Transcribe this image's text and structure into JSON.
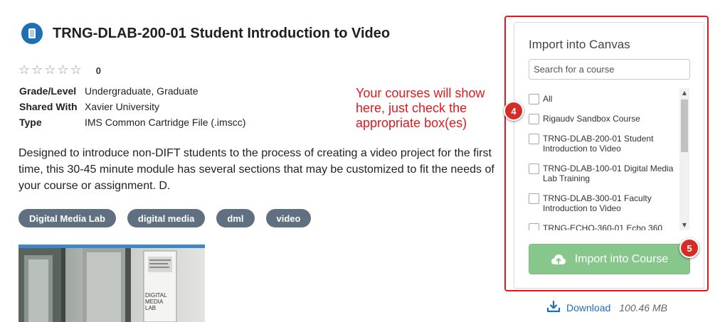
{
  "resource": {
    "title": "TRNG-DLAB-200-01 Student Introduction to Video",
    "rating_count": "0",
    "meta": [
      {
        "label": "Grade/Level",
        "value": "Undergraduate, Graduate"
      },
      {
        "label": "Shared With",
        "value": "Xavier University"
      },
      {
        "label": "Type",
        "value": "IMS Common Cartridge File (.imscc)"
      }
    ],
    "description": "Designed to introduce non-DIFT students to the process of creating a video project for the first time, this 30-45 minute module has several sections that may be customized to fit the needs of your course or assignment. D.",
    "tags": [
      "Digital Media Lab",
      "digital media",
      "dml",
      "video"
    ],
    "thumbnail_sign_text": "DIGITAL MEDIA LAB"
  },
  "annotation": {
    "text_lines": [
      "Your courses will show",
      "here, just check the",
      "appropriate box(es)"
    ],
    "color": "#e0191d"
  },
  "import_panel": {
    "title": "Import into Canvas",
    "search_placeholder": "Search for a course",
    "courses": [
      {
        "label": "All",
        "checked": false
      },
      {
        "label": "Rigaudv Sandbox Course",
        "checked": false
      },
      {
        "label": "TRNG-DLAB-200-01 Student Introduction to Video",
        "checked": false
      },
      {
        "label": "TRNG-DLAB-100-01 Digital Media Lab Training",
        "checked": false
      },
      {
        "label": "TRNG-DLAB-300-01 Faculty Introduction to Video",
        "checked": false
      },
      {
        "label": "TRNG-ECHO-360-01 Echo 360",
        "checked": false
      }
    ],
    "import_button_label": "Import into Course",
    "button_color": "#88c78c",
    "badges": {
      "courses_step": "4",
      "import_step": "5"
    },
    "badge_color": "#d72b25"
  },
  "download": {
    "label": "Download",
    "size": "100.46 MB"
  },
  "icons": {
    "title": "document-icon",
    "rating": "star-outline-icon",
    "import": "cloud-upload-icon",
    "download": "download-icon"
  },
  "colors": {
    "brand_blue": "#1f6fb5",
    "tag_bg": "#607080",
    "highlight_border": "#e8161b"
  }
}
